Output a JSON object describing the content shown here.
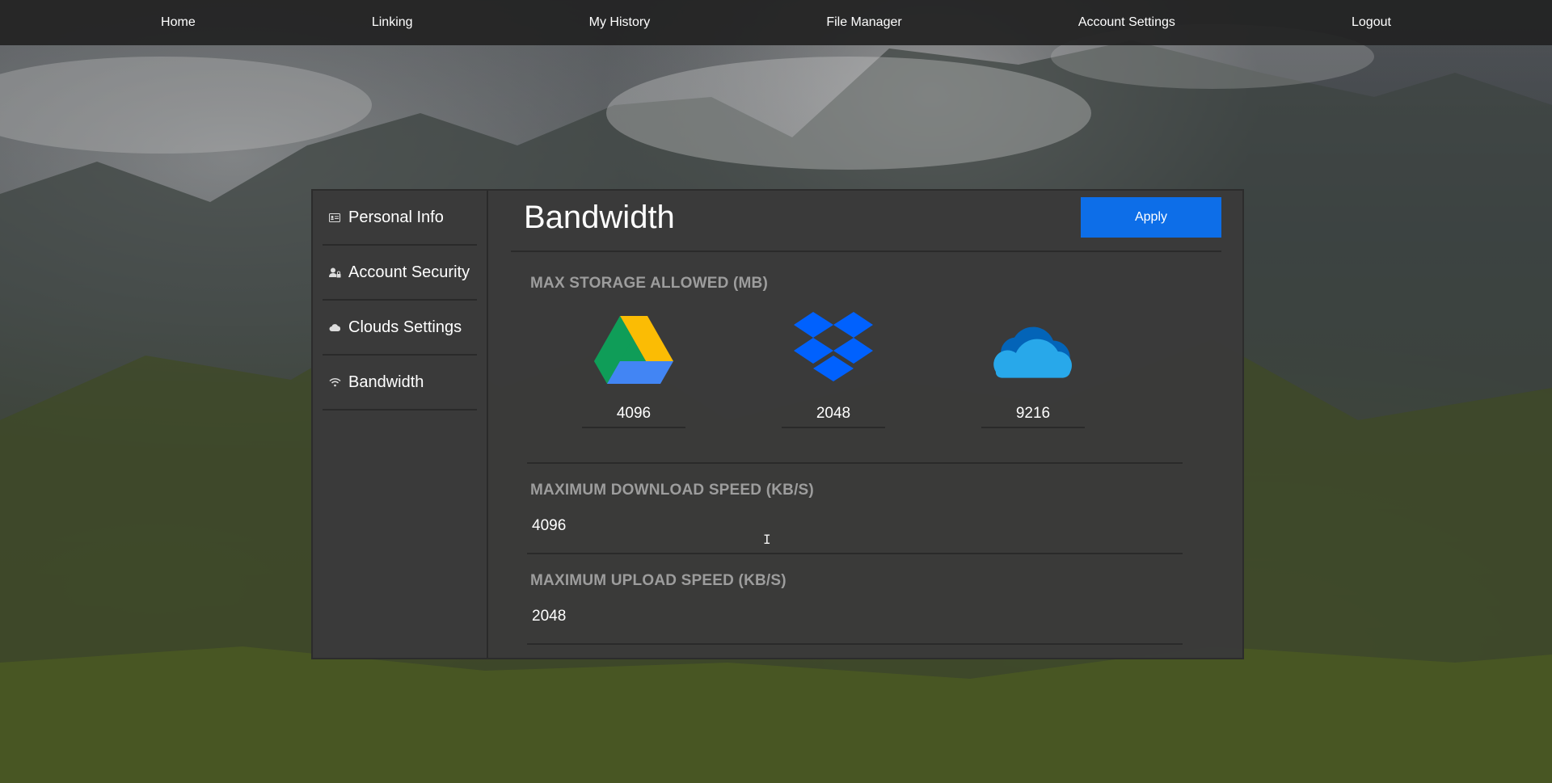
{
  "nav": {
    "items": [
      {
        "label": "Home"
      },
      {
        "label": "Linking"
      },
      {
        "label": "My History"
      },
      {
        "label": "File Manager"
      },
      {
        "label": "Account Settings"
      },
      {
        "label": "Logout"
      }
    ]
  },
  "sidebar": {
    "items": [
      {
        "label": "Personal Info",
        "icon": "id-card-icon"
      },
      {
        "label": "Account Security",
        "icon": "user-lock-icon"
      },
      {
        "label": "Clouds Settings",
        "icon": "cloud-icon"
      },
      {
        "label": "Bandwidth",
        "icon": "wifi-icon"
      }
    ]
  },
  "content": {
    "title": "Bandwidth",
    "apply_label": "Apply",
    "storage": {
      "label": "MAX STORAGE ALLOWED (MB)",
      "clouds": [
        {
          "name": "google-drive-icon",
          "value": "4096"
        },
        {
          "name": "dropbox-icon",
          "value": "2048"
        },
        {
          "name": "onedrive-icon",
          "value": "9216"
        }
      ]
    },
    "download": {
      "label": "MAXIMUM DOWNLOAD SPEED (KB/S)",
      "value": "4096"
    },
    "upload": {
      "label": "MAXIMUM UPLOAD SPEED (KB/S)",
      "value": "2048"
    }
  },
  "colors": {
    "accent": "#0d6ee8",
    "panel": "#3a3a3a",
    "nav": "#222222"
  }
}
